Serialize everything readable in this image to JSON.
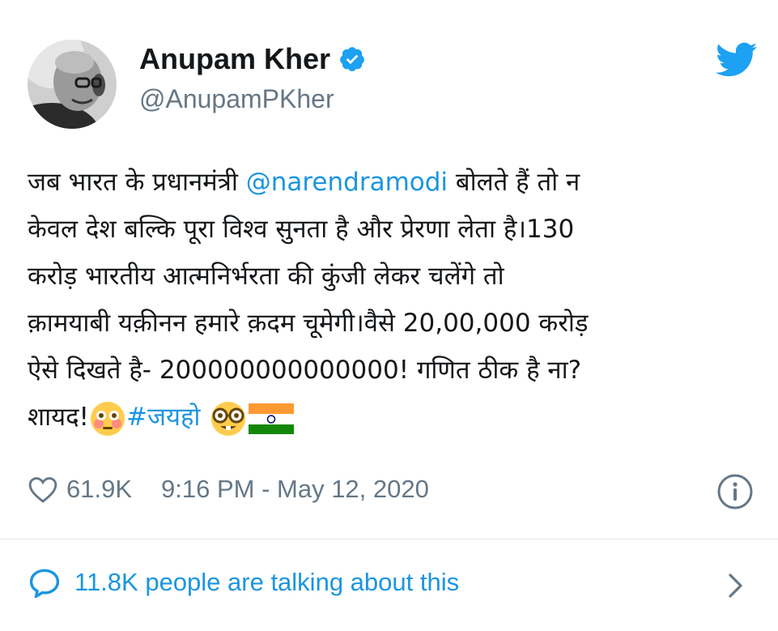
{
  "author": {
    "name": "Anupam Kher",
    "handle": "@AnupamPKher"
  },
  "tweet": {
    "line1_pre": "जब भारत के प्रधानमंत्री ",
    "mention": "@narendramodi",
    "line1_post": " बोलते हैं तो न",
    "line2": "केवल देश बल्कि पूरा विश्व सुनता है और प्रेरणा लेता है।130",
    "line3": "करोड़ भारतीय आत्मनिर्भरता की कुंजी लेकर चलेंगे तो",
    "line4": "क़ामयाबी यक़ीनन हमारे क़दम चूमेगी।वैसे 20,00,000 करोड़",
    "line5": "ऐसे दिखते है- 200000000000000! गणित ठीक है ना?",
    "line6_pre": "शायद!",
    "hashtag": "#जयहो",
    "emojis": [
      "flushed-face",
      "nerd-face",
      "india-flag"
    ]
  },
  "meta": {
    "likes": "61.9K",
    "timestamp": "9:16 PM - May 12, 2020"
  },
  "footer": {
    "talking": "11.8K people are talking about this"
  },
  "colors": {
    "link": "#1b95e0",
    "secondary": "#657786",
    "verified": "#1da1f2",
    "twitter_blue": "#1da1f2"
  }
}
